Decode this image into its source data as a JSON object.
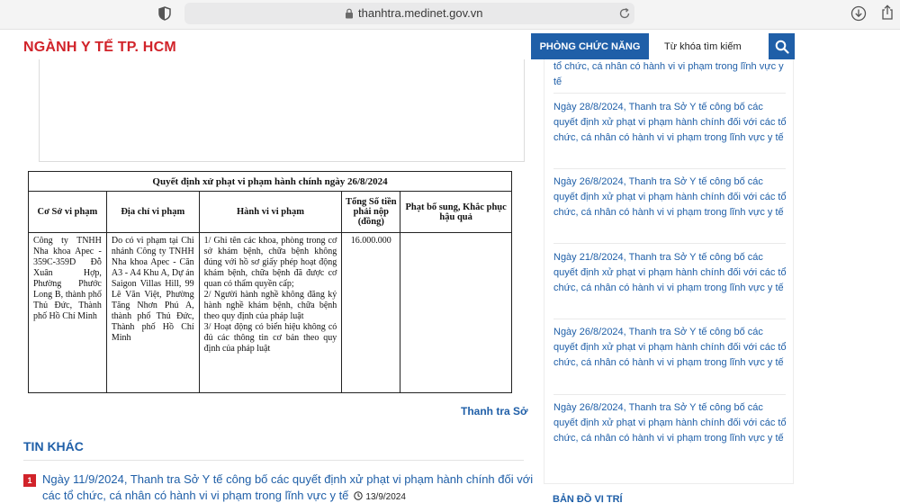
{
  "browser": {
    "url": "thanhtra.medinet.gov.vn"
  },
  "header": {
    "site_title": "NGÀNH Y TẾ TP. HCM",
    "function_button": "PHÒNG CHỨC NĂNG",
    "search_placeholder": "Từ khóa tìm kiếm"
  },
  "decision_table": {
    "title": "Quyết định xử phạt vi phạm hành chính ngày 26/8/2024",
    "headers": [
      "Cơ Sở vi phạm",
      "Địa chỉ vi phạm",
      "Hành vi vi phạm",
      "Tổng Số tiền phải nộp (đồng)",
      "Phạt bổ sung, Khắc phục hậu quả"
    ],
    "row": {
      "facility": "Công ty TNHH Nha khoa Apec - 359C-359D Đỗ Xuân Hợp, Phường Phước Long B, thành phố Thủ Đức, Thành phố Hồ Chí Minh",
      "address": "Do có vi phạm tại Chi nhánh Công ty TNHH Nha khoa Apec - Căn A3 - A4 Khu A, Dự án Saigon Villas Hill, 99 Lê Văn Việt, Phường Tăng Nhơn Phú A, thành phố Thủ Đức, Thành phố Hồ Chí Minh",
      "violations": [
        "1/ Ghi tên các khoa, phòng trong cơ sở khám bệnh, chữa bệnh không đúng với hồ sơ giấy phép hoạt động khám bệnh, chữa bệnh đã được cơ quan có thẩm quyền cấp;",
        "2/ Người hành nghề không đăng ký hành nghề khám bệnh, chữa bệnh theo quy định của pháp luật",
        "3/ Hoạt động có biển hiệu không có đủ các thông tin cơ bản theo quy định của pháp luật"
      ],
      "amount": "16.000.000",
      "additional": ""
    }
  },
  "source": "Thanh tra Sở",
  "other_news": {
    "title": "TIN KHÁC",
    "items": [
      {
        "number": "1",
        "text": "Ngày 11/9/2024, Thanh tra Sở Y tế công bố các quyết định xử phạt vi phạm hành chính đối với các tổ chức, cá nhân có hành vi vi phạm trong lĩnh vực y tế",
        "date": "13/9/2024"
      }
    ]
  },
  "sidebar": {
    "items": [
      "tổ chức, cá nhân có hành vi vi phạm trong lĩnh vực y tế",
      "Ngày 28/8/2024, Thanh tra Sở Y tế công bố các quyết định xử phạt vi phạm hành chính đối với các tổ chức, cá nhân có hành vi vi phạm trong lĩnh vực y tế",
      "Ngày 26/8/2024, Thanh tra Sở Y tế công bố các quyết định xử phạt vi phạm hành chính đối với các tổ chức, cá nhân có hành vi vi phạm trong lĩnh vực y tế",
      "Ngày 21/8/2024, Thanh tra Sở Y tế công bố các quyết định xử phạt vi phạm hành chính đối với các tổ chức, cá nhân có hành vi vi phạm trong lĩnh vực y tế",
      "Ngày 26/8/2024, Thanh tra Sở Y tế công bố các quyết định xử phạt vi phạm hành chính đối với các tổ chức, cá nhân có hành vi vi phạm trong lĩnh vực y tế",
      "Ngày 26/8/2024, Thanh tra Sở Y tế công bố các quyết định xử phạt vi phạm hành chính đối với các tổ chức, cá nhân có hành vi vi phạm trong lĩnh vực y tế"
    ],
    "map_title": "BẢN ĐỒ VỊ TRÍ"
  }
}
